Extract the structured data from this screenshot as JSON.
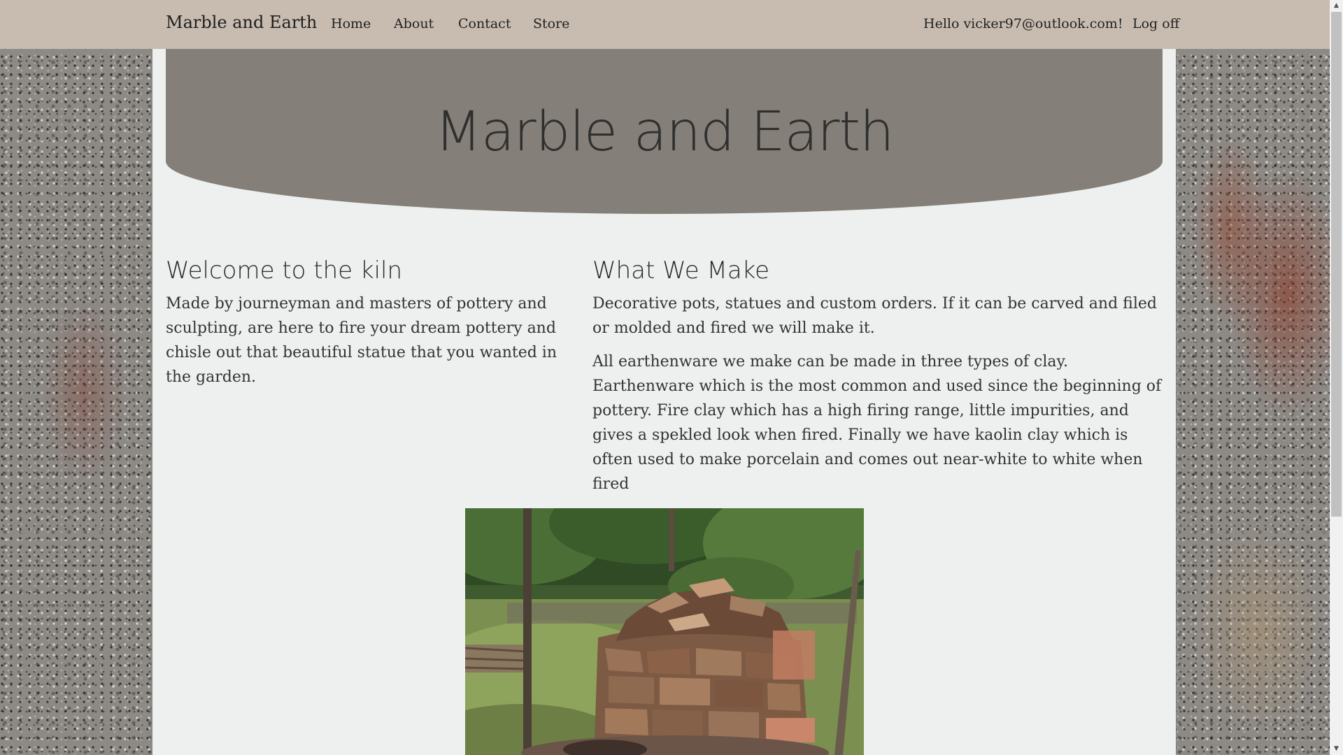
{
  "navbar": {
    "brand": "Marble and Earth",
    "links": [
      "Home",
      "About",
      "Contact",
      "Store"
    ],
    "greeting": "Hello vicker97@outlook.com!",
    "logoff": "Log off"
  },
  "hero": {
    "title": "Marble and Earth"
  },
  "welcome": {
    "heading": "Welcome to the kiln",
    "text": "Made by journeyman and masters of pottery and sculpting, are here to fire your dream pottery and chisle out that beautiful statue that you wanted in the garden."
  },
  "what_we_make": {
    "heading": "What We Make",
    "paragraphs": [
      "Decorative pots, statues and custom orders. If it can be carved and filed or molded and fired we will make it.",
      "All earthenware we make can be made in three types of clay. Earthenware which is the most common and used since the beginning of pottery. Fire clay which has a high firing range, little impurities, and gives a spekled look when fired. Finally we have kaolin clay which is often used to make porcelain and comes out near-white to white when fired"
    ]
  },
  "image": {
    "subject": "stone kiln outdoors"
  },
  "colors": {
    "navbar_bg": "#c8bcb0",
    "hero_bg": "#847f78",
    "panel_bg": "#edf0ee"
  },
  "icons": {
    "scroll_up": "scroll-up-arrow-icon",
    "scroll_down": "scroll-down-arrow-icon"
  }
}
